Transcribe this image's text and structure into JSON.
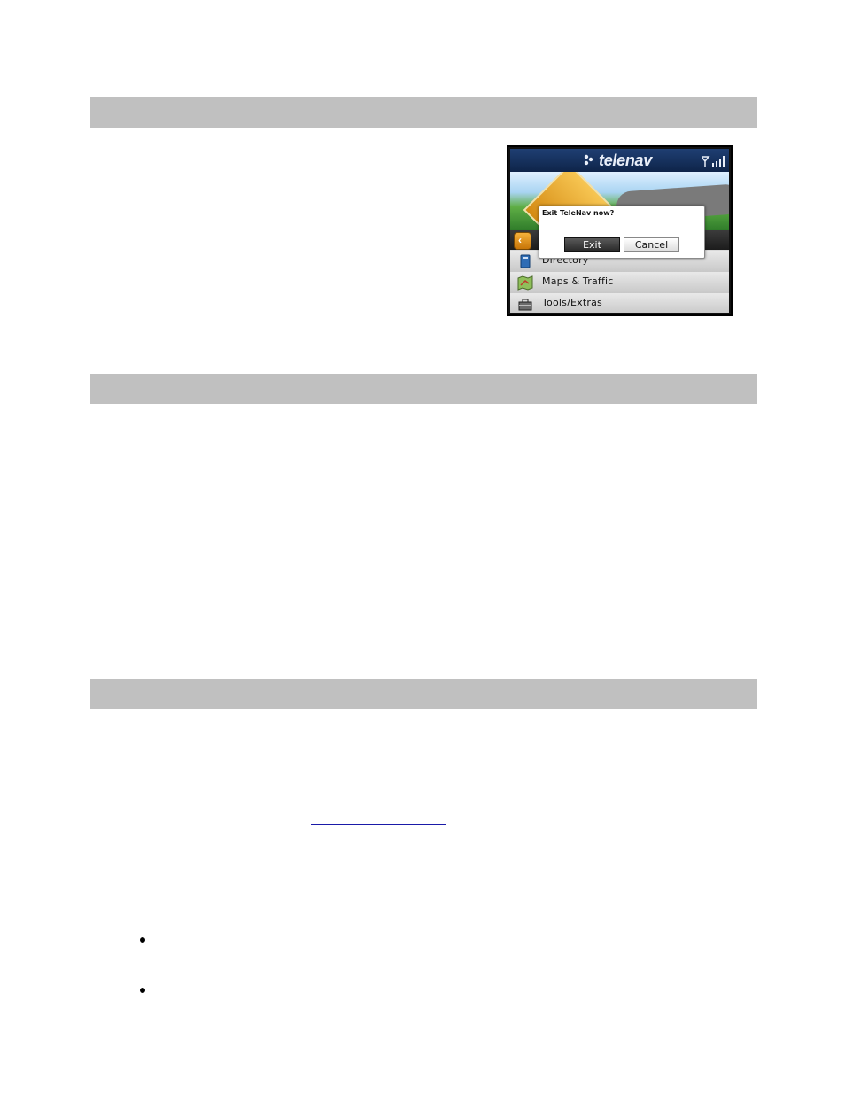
{
  "phone": {
    "brand": "telenav",
    "dialog": {
      "message": "Exit TeleNav now?",
      "exit_label": "Exit",
      "cancel_label": "Cancel"
    },
    "menu_items": [
      {
        "label": "Directory",
        "icon": "directory-icon"
      },
      {
        "label": "Maps & Traffic",
        "icon": "map-icon"
      },
      {
        "label": "Tools/Extras",
        "icon": "toolbox-icon"
      }
    ]
  }
}
